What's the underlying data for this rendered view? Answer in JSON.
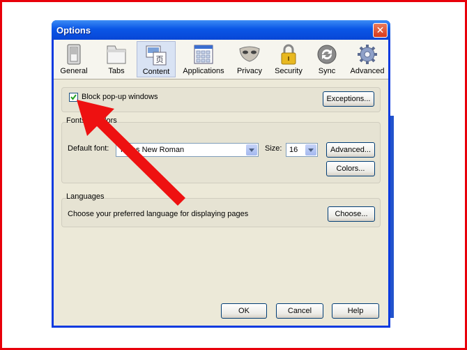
{
  "window": {
    "title": "Options"
  },
  "toolbar": {
    "panes": [
      {
        "label": "General",
        "icon": "switch-icon"
      },
      {
        "label": "Tabs",
        "icon": "tabs-icon"
      },
      {
        "label": "Content",
        "icon": "content-icon"
      },
      {
        "label": "Applications",
        "icon": "applications-icon"
      },
      {
        "label": "Privacy",
        "icon": "mask-icon"
      },
      {
        "label": "Security",
        "icon": "lock-icon"
      },
      {
        "label": "Sync",
        "icon": "sync-icon"
      },
      {
        "label": "Advanced",
        "icon": "gear-icon"
      }
    ],
    "selected": "Content"
  },
  "popups": {
    "checkbox_label": "Block pop-up windows",
    "checked": true,
    "exceptions": "Exceptions..."
  },
  "fonts": {
    "group_label": "Fonts & Colors",
    "default_font_label": "Default font:",
    "default_font_value": "Times New Roman",
    "size_label": "Size:",
    "size_value": "16",
    "advanced": "Advanced...",
    "colors": "Colors..."
  },
  "languages": {
    "group_label": "Languages",
    "description": "Choose your preferred language for displaying pages",
    "choose": "Choose..."
  },
  "footer": {
    "ok": "OK",
    "cancel": "Cancel",
    "help": "Help"
  },
  "colors": {
    "frame": "#e8000a",
    "titlebar": "#0a56e6",
    "annotation_arrow": "#ee1111"
  }
}
